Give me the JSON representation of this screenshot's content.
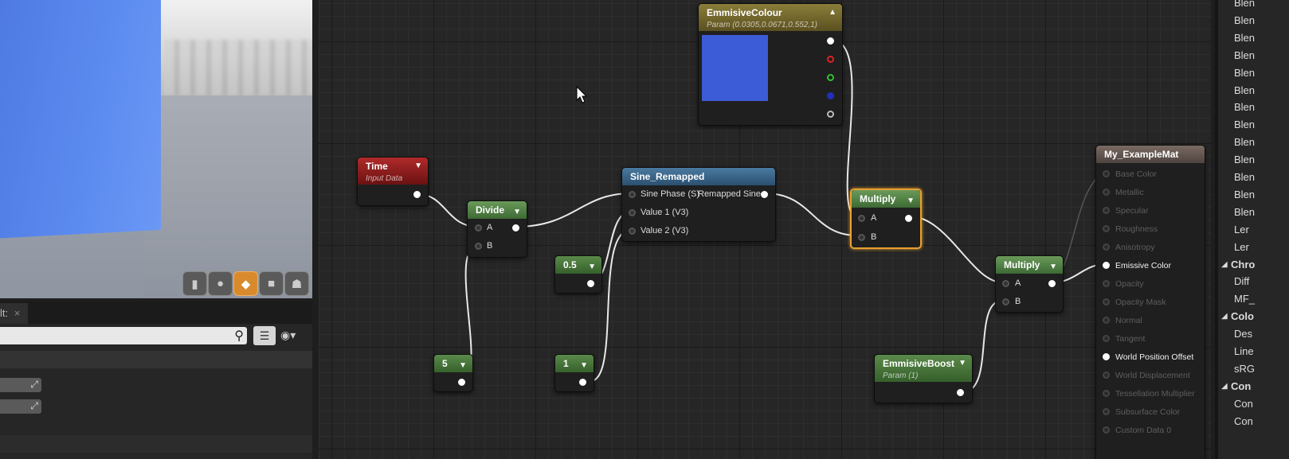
{
  "viewport": {
    "buttons": [
      "cylinder-icon",
      "sphere-icon",
      "plane-icon",
      "cube-icon",
      "teapot-icon"
    ],
    "active_button": 2
  },
  "details": {
    "tab_label": "lt:",
    "tab_close": "×",
    "eye_arrow": "▾"
  },
  "graph": {
    "nodes": {
      "emissive_colour": {
        "title": "EmmisiveColour",
        "subtitle": "Param (0.0305,0.0671,0.552,1)",
        "swatch_color": "#3c5bd6"
      },
      "time": {
        "title": "Time",
        "subtitle": "Input Data"
      },
      "divide": {
        "title": "Divide",
        "in_a": "A",
        "in_b": "B"
      },
      "sine": {
        "title": "Sine_Remapped",
        "in_phase": "Sine Phase (S)",
        "out": "Remapped Sine",
        "in_v1": "Value 1 (V3)",
        "in_v2": "Value 2 (V3)"
      },
      "const_05": {
        "title": "0.5"
      },
      "const_5": {
        "title": "5"
      },
      "const_1": {
        "title": "1"
      },
      "multiply1": {
        "title": "Multiply",
        "in_a": "A",
        "in_b": "B"
      },
      "multiply2": {
        "title": "Multiply",
        "in_a": "A",
        "in_b": "B"
      },
      "boost": {
        "title": "EmmisiveBoost",
        "subtitle": "Param (1)"
      },
      "material": {
        "title": "My_ExampleMat",
        "inputs": [
          {
            "label": "Base Color",
            "active": false
          },
          {
            "label": "Metallic",
            "active": false
          },
          {
            "label": "Specular",
            "active": false
          },
          {
            "label": "Roughness",
            "active": false
          },
          {
            "label": "Anisotropy",
            "active": false
          },
          {
            "label": "Emissive Color",
            "active": true
          },
          {
            "label": "Opacity",
            "active": false
          },
          {
            "label": "Opacity Mask",
            "active": false
          },
          {
            "label": "Normal",
            "active": false
          },
          {
            "label": "Tangent",
            "active": false
          },
          {
            "label": "World Position Offset",
            "active": true
          },
          {
            "label": "World Displacement",
            "active": false
          },
          {
            "label": "Tessellation Multiplier",
            "active": false
          },
          {
            "label": "Subsurface Color",
            "active": false
          },
          {
            "label": "Custom Data 0",
            "active": false
          }
        ]
      }
    }
  },
  "palette": {
    "items": [
      {
        "label": "Blen",
        "type": "item"
      },
      {
        "label": "Blen",
        "type": "item"
      },
      {
        "label": "Blen",
        "type": "item"
      },
      {
        "label": "Blen",
        "type": "item"
      },
      {
        "label": "Blen",
        "type": "item"
      },
      {
        "label": "Blen",
        "type": "item"
      },
      {
        "label": "Blen",
        "type": "item"
      },
      {
        "label": "Blen",
        "type": "item"
      },
      {
        "label": "Blen",
        "type": "item"
      },
      {
        "label": "Blen",
        "type": "item"
      },
      {
        "label": "Blen",
        "type": "item"
      },
      {
        "label": "Blen",
        "type": "item"
      },
      {
        "label": "Blen",
        "type": "item"
      },
      {
        "label": "Ler",
        "type": "item"
      },
      {
        "label": "Ler",
        "type": "item"
      },
      {
        "label": "Chro",
        "type": "category"
      },
      {
        "label": "Diff",
        "type": "item"
      },
      {
        "label": "MF_",
        "type": "item"
      },
      {
        "label": "Colo",
        "type": "category"
      },
      {
        "label": "Des",
        "type": "item"
      },
      {
        "label": "Line",
        "type": "item"
      },
      {
        "label": "sRG",
        "type": "item"
      },
      {
        "label": "Con",
        "type": "category"
      },
      {
        "label": "Con",
        "type": "item"
      },
      {
        "label": "Con",
        "type": "item"
      }
    ]
  }
}
